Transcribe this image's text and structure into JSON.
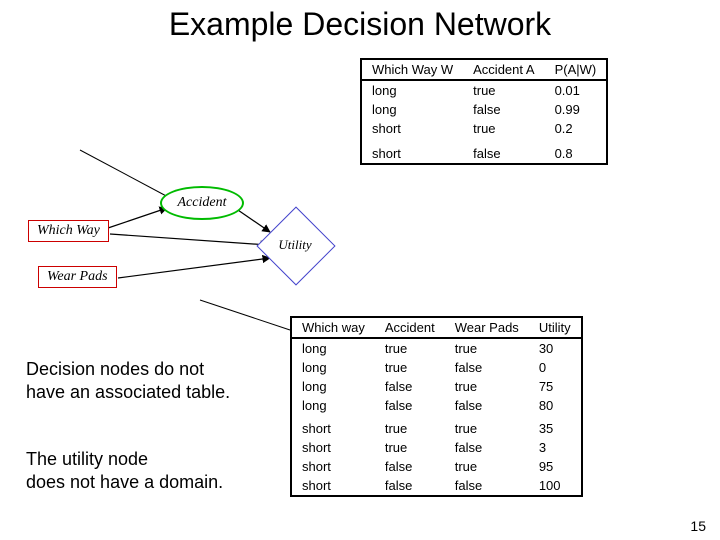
{
  "title": "Example Decision Network",
  "page_number": "15",
  "prob_table": {
    "headers": [
      "Which Way W",
      "Accident A",
      "P(A|W)"
    ],
    "rows": [
      {
        "w": "long",
        "a": "true",
        "p": "0.01"
      },
      {
        "w": "long",
        "a": "false",
        "p": "0.99"
      },
      {
        "w": "short",
        "a": "true",
        "p": "0.2"
      },
      {
        "w": "short",
        "a": "false",
        "p": "0.8"
      }
    ]
  },
  "diagram": {
    "which_way": "Which Way",
    "accident": "Accident",
    "wear_pads": "Wear Pads",
    "utility": "Utility"
  },
  "util_table": {
    "headers": [
      "Which way",
      "Accident",
      "Wear Pads",
      "Utility"
    ],
    "rows": [
      {
        "w": "long",
        "a": "true",
        "p": "true",
        "u": "30"
      },
      {
        "w": "long",
        "a": "true",
        "p": "false",
        "u": "0"
      },
      {
        "w": "long",
        "a": "false",
        "p": "true",
        "u": "75"
      },
      {
        "w": "long",
        "a": "false",
        "p": "false",
        "u": "80"
      },
      {
        "w": "short",
        "a": "true",
        "p": "true",
        "u": "35"
      },
      {
        "w": "short",
        "a": "true",
        "p": "false",
        "u": "3"
      },
      {
        "w": "short",
        "a": "false",
        "p": "true",
        "u": "95"
      },
      {
        "w": "short",
        "a": "false",
        "p": "false",
        "u": "100"
      }
    ]
  },
  "body_text_1a": "Decision nodes do not",
  "body_text_1b": "have an associated table.",
  "body_text_2a": "The utility node",
  "body_text_2b": "does not have a domain."
}
